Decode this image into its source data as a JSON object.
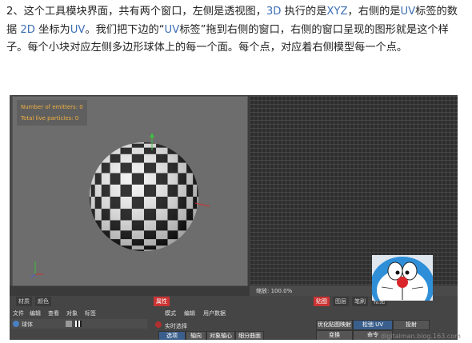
{
  "paragraph": {
    "segments": [
      {
        "text": "2、这个工具模块界面，共有两个窗口，左侧是透视图，",
        "hl": false
      },
      {
        "text": "3D",
        "hl": true
      },
      {
        "text": " 执行的是",
        "hl": false
      },
      {
        "text": "XYZ",
        "hl": true
      },
      {
        "text": "，右侧的是",
        "hl": false
      },
      {
        "text": "UV",
        "hl": true
      },
      {
        "text": "标签的数据 ",
        "hl": false
      },
      {
        "text": "2D",
        "hl": true
      },
      {
        "text": " 坐标为",
        "hl": false
      },
      {
        "text": "UV",
        "hl": true
      },
      {
        "text": "。我们把下边的“",
        "hl": false
      },
      {
        "text": "UV",
        "hl": true
      },
      {
        "text": "标签”拖到右侧的窗口，右侧的窗口呈现的图形就是这个样子。每个小块对应左侧多边形球体上的每一个面。每个点，对应着右侧模型每一个点。",
        "hl": false
      }
    ]
  },
  "viewport": {
    "hud_line1": "Number of emitters: 0",
    "hud_line2": "Total live particles: 0"
  },
  "uv_panel": {
    "zoom_label": "缩放: 100.0%"
  },
  "lower_left": {
    "tabs": [
      "材质",
      "颜色"
    ],
    "menu": [
      "文件",
      "编辑",
      "查看",
      "对象",
      "标签"
    ],
    "object_name": "球体"
  },
  "lower_mid": {
    "tab": "属性",
    "menu": [
      "模式",
      "编辑",
      "用户数据"
    ],
    "checkbox_label": "实时选择",
    "subtabs": [
      "选项",
      "轴向",
      "对象轴心",
      "细分曲面"
    ]
  },
  "lower_right": {
    "tabs": [
      "贴图",
      "图层",
      "笔刷",
      "松弛"
    ],
    "buttons": [
      "优化贴图映射",
      "松弛 UV",
      "投射",
      "变换",
      "命令"
    ]
  },
  "watermark": "digitalman.blog.163.com",
  "colors": {
    "link_blue": "#3d6fb6",
    "hud_orange": "#f0b040",
    "active_tab_red": "#cc3333"
  }
}
